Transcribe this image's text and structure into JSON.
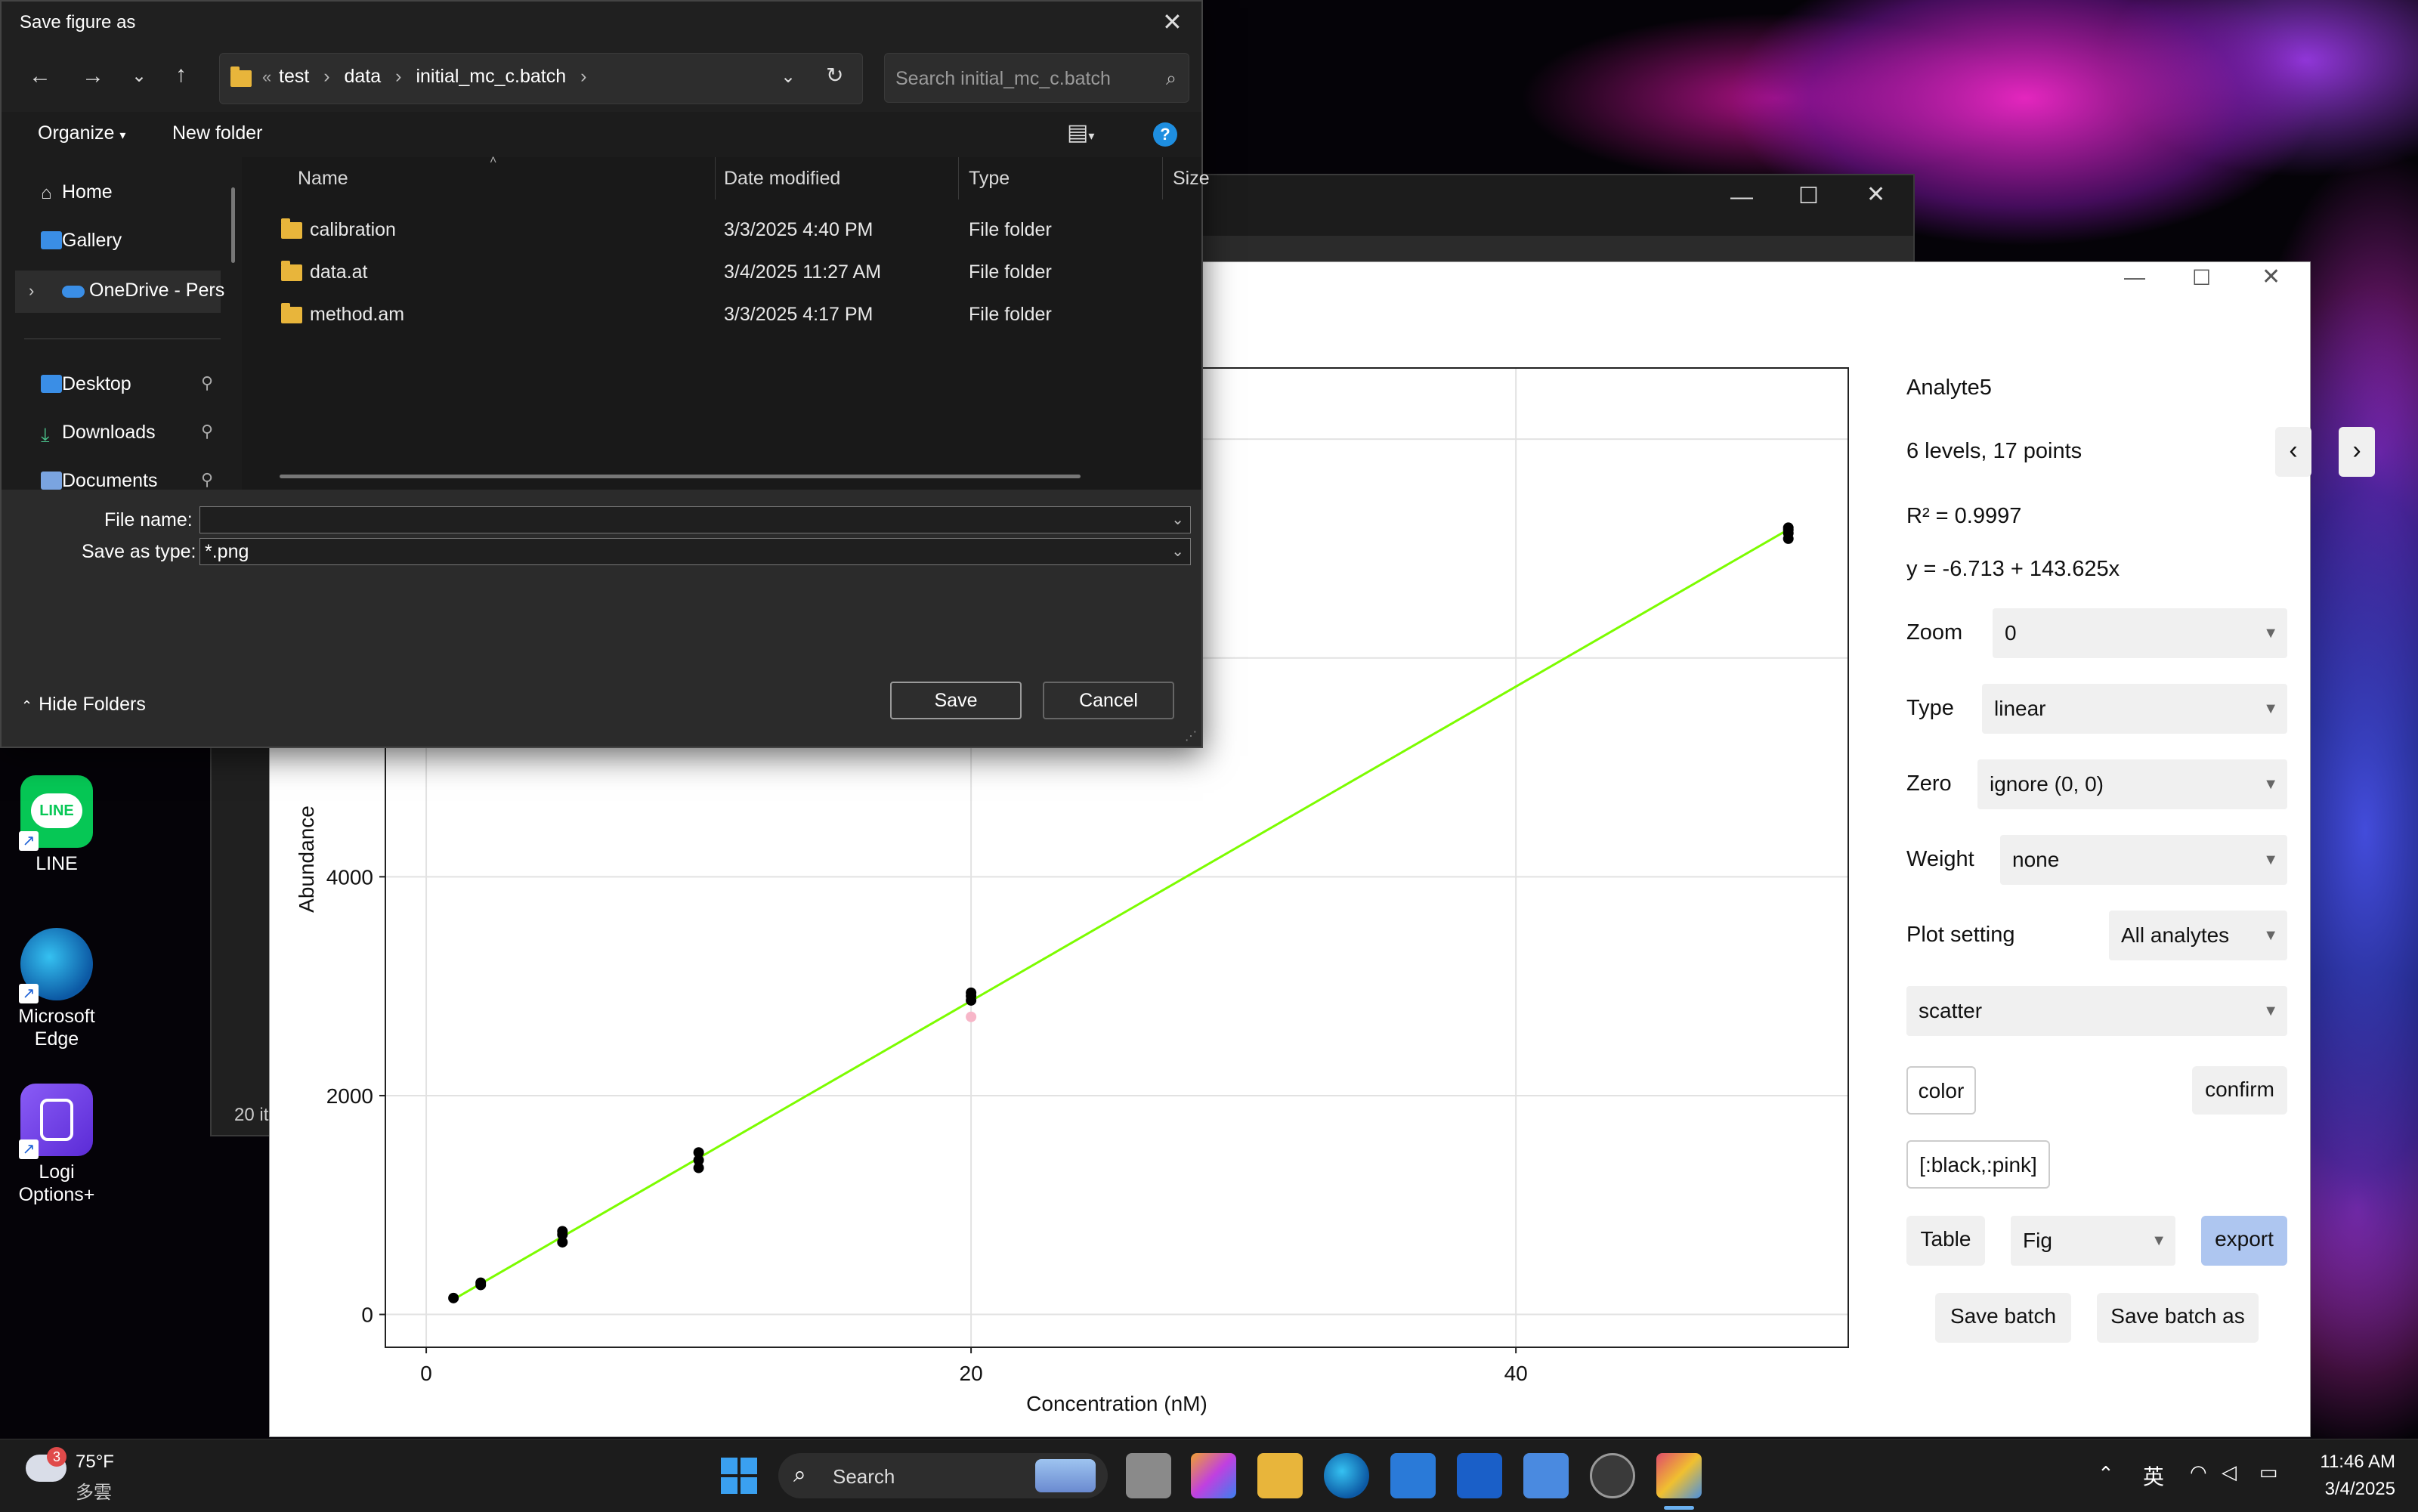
{
  "dialog": {
    "title": "Save figure as",
    "breadcrumb": [
      "test",
      "data",
      "initial_mc_c.batch"
    ],
    "search_placeholder": "Search initial_mc_c.batch",
    "organize": "Organize",
    "new_folder": "New folder",
    "nav": [
      "Home",
      "Gallery",
      "OneDrive - Pers",
      "Desktop",
      "Downloads",
      "Documents"
    ],
    "columns": [
      "Name",
      "Date modified",
      "Type",
      "Size"
    ],
    "files": [
      {
        "name": "calibration",
        "date": "3/3/2025 4:40 PM",
        "type": "File folder"
      },
      {
        "name": "data.at",
        "date": "3/4/2025 11:27 AM",
        "type": "File folder"
      },
      {
        "name": "method.am",
        "date": "3/3/2025 4:17 PM",
        "type": "File folder"
      }
    ],
    "file_name_label": "File name:",
    "file_name_value": "",
    "save_type_label": "Save as type:",
    "save_type_value": "*.png",
    "save": "Save",
    "cancel": "Cancel",
    "hide_folders": "Hide Folders"
  },
  "bg_explorer": {
    "status": "20 it"
  },
  "desktop_icons": [
    {
      "label": "LINE",
      "icon": "line-icon"
    },
    {
      "label": "Microsoft Edge",
      "icon": "edge-icon"
    },
    {
      "label": "Logi Options+",
      "icon": "logi-icon"
    }
  ],
  "panel": {
    "analyte": "Analyte5",
    "levels": "6 levels, 17 points",
    "r2": "R² = 0.9997",
    "equation": "y = -6.713 + 143.625x",
    "zoom_label": "Zoom",
    "zoom_value": "0",
    "type_label": "Type",
    "type_value": "linear",
    "zero_label": "Zero",
    "zero_value": "ignore (0, 0)",
    "weight_label": "Weight",
    "weight_value": "none",
    "plot_setting_label": "Plot setting",
    "plot_setting_value": "All analytes",
    "plot_kind": "scatter",
    "color_button": "color",
    "confirm_button": "confirm",
    "color_value": "[:black,:pink]",
    "table_button": "Table",
    "fig_value": "Fig",
    "export_button": "export",
    "save_batch": "Save batch",
    "save_batch_as": "Save batch as",
    "prev": "‹",
    "next": "›"
  },
  "chart_data": {
    "type": "scatter",
    "xlabel": "Concentration (nM)",
    "ylabel": "Abundance",
    "xlim": [
      -1.5,
      52.2
    ],
    "ylim": [
      -300,
      8650
    ],
    "xticks": [
      0,
      20,
      40
    ],
    "yticks": [
      0,
      2000,
      4000
    ],
    "grid": true,
    "points": [
      {
        "x": 1,
        "y": 150,
        "c": "black"
      },
      {
        "x": 2,
        "y": 270,
        "c": "black"
      },
      {
        "x": 2,
        "y": 290,
        "c": "black"
      },
      {
        "x": 5,
        "y": 660,
        "c": "black"
      },
      {
        "x": 5,
        "y": 730,
        "c": "black"
      },
      {
        "x": 5,
        "y": 760,
        "c": "black"
      },
      {
        "x": 10,
        "y": 1340,
        "c": "black"
      },
      {
        "x": 10,
        "y": 1410,
        "c": "black"
      },
      {
        "x": 10,
        "y": 1480,
        "c": "black"
      },
      {
        "x": 20,
        "y": 2720,
        "c": "pink"
      },
      {
        "x": 20,
        "y": 2870,
        "c": "black"
      },
      {
        "x": 20,
        "y": 2910,
        "c": "black"
      },
      {
        "x": 20,
        "y": 2940,
        "c": "black"
      },
      {
        "x": 50,
        "y": 7090,
        "c": "black"
      },
      {
        "x": 50,
        "y": 7140,
        "c": "black"
      },
      {
        "x": 50,
        "y": 7170,
        "c": "black"
      },
      {
        "x": 50,
        "y": 7190,
        "c": "black"
      }
    ],
    "fit": {
      "intercept": -6.713,
      "slope": 143.625,
      "x_range": [
        1,
        50
      ],
      "color": "#7cfc00"
    }
  },
  "taskbar": {
    "weather_temp": "75°F",
    "weather_desc": "多雲",
    "weather_badge": "3",
    "search": "Search",
    "ime": "英",
    "time": "11:46 AM",
    "date": "3/4/2025"
  }
}
